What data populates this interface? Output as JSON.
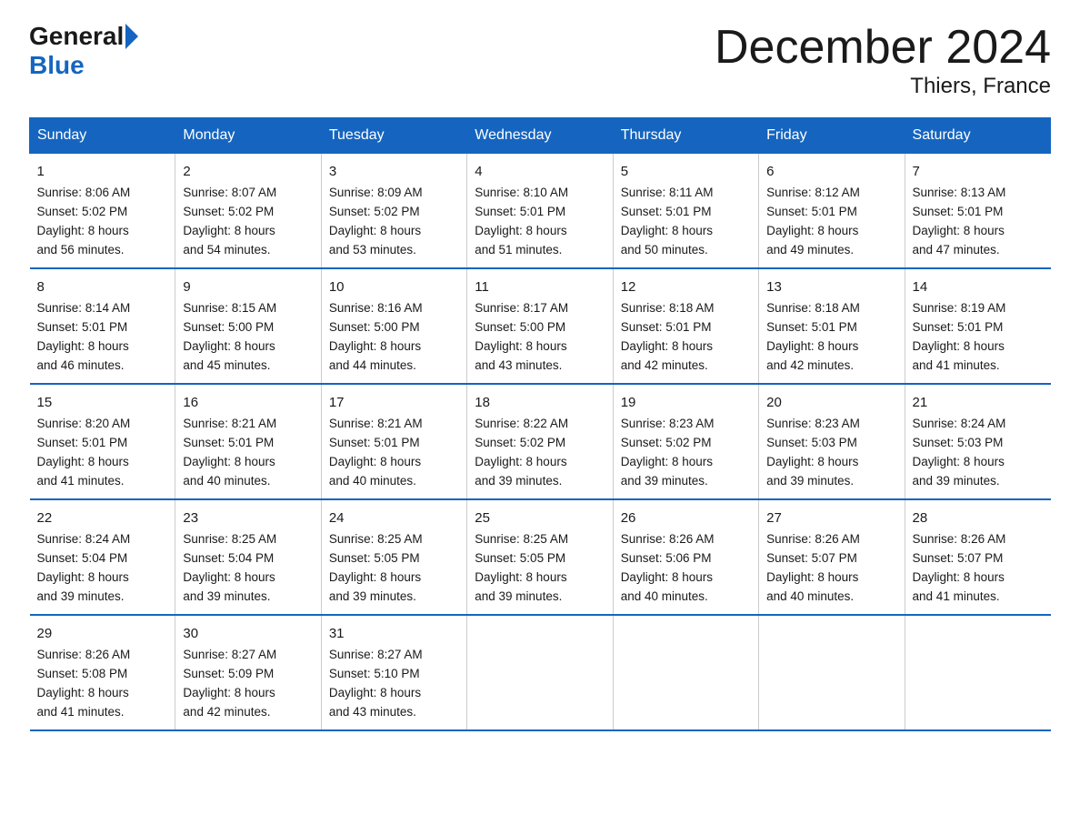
{
  "logo": {
    "general": "General",
    "blue": "Blue"
  },
  "title": "December 2024",
  "subtitle": "Thiers, France",
  "days_of_week": [
    "Sunday",
    "Monday",
    "Tuesday",
    "Wednesday",
    "Thursday",
    "Friday",
    "Saturday"
  ],
  "weeks": [
    [
      {
        "day": "1",
        "sunrise": "8:06 AM",
        "sunset": "5:02 PM",
        "daylight": "8 hours and 56 minutes."
      },
      {
        "day": "2",
        "sunrise": "8:07 AM",
        "sunset": "5:02 PM",
        "daylight": "8 hours and 54 minutes."
      },
      {
        "day": "3",
        "sunrise": "8:09 AM",
        "sunset": "5:02 PM",
        "daylight": "8 hours and 53 minutes."
      },
      {
        "day": "4",
        "sunrise": "8:10 AM",
        "sunset": "5:01 PM",
        "daylight": "8 hours and 51 minutes."
      },
      {
        "day": "5",
        "sunrise": "8:11 AM",
        "sunset": "5:01 PM",
        "daylight": "8 hours and 50 minutes."
      },
      {
        "day": "6",
        "sunrise": "8:12 AM",
        "sunset": "5:01 PM",
        "daylight": "8 hours and 49 minutes."
      },
      {
        "day": "7",
        "sunrise": "8:13 AM",
        "sunset": "5:01 PM",
        "daylight": "8 hours and 47 minutes."
      }
    ],
    [
      {
        "day": "8",
        "sunrise": "8:14 AM",
        "sunset": "5:01 PM",
        "daylight": "8 hours and 46 minutes."
      },
      {
        "day": "9",
        "sunrise": "8:15 AM",
        "sunset": "5:00 PM",
        "daylight": "8 hours and 45 minutes."
      },
      {
        "day": "10",
        "sunrise": "8:16 AM",
        "sunset": "5:00 PM",
        "daylight": "8 hours and 44 minutes."
      },
      {
        "day": "11",
        "sunrise": "8:17 AM",
        "sunset": "5:00 PM",
        "daylight": "8 hours and 43 minutes."
      },
      {
        "day": "12",
        "sunrise": "8:18 AM",
        "sunset": "5:01 PM",
        "daylight": "8 hours and 42 minutes."
      },
      {
        "day": "13",
        "sunrise": "8:18 AM",
        "sunset": "5:01 PM",
        "daylight": "8 hours and 42 minutes."
      },
      {
        "day": "14",
        "sunrise": "8:19 AM",
        "sunset": "5:01 PM",
        "daylight": "8 hours and 41 minutes."
      }
    ],
    [
      {
        "day": "15",
        "sunrise": "8:20 AM",
        "sunset": "5:01 PM",
        "daylight": "8 hours and 41 minutes."
      },
      {
        "day": "16",
        "sunrise": "8:21 AM",
        "sunset": "5:01 PM",
        "daylight": "8 hours and 40 minutes."
      },
      {
        "day": "17",
        "sunrise": "8:21 AM",
        "sunset": "5:01 PM",
        "daylight": "8 hours and 40 minutes."
      },
      {
        "day": "18",
        "sunrise": "8:22 AM",
        "sunset": "5:02 PM",
        "daylight": "8 hours and 39 minutes."
      },
      {
        "day": "19",
        "sunrise": "8:23 AM",
        "sunset": "5:02 PM",
        "daylight": "8 hours and 39 minutes."
      },
      {
        "day": "20",
        "sunrise": "8:23 AM",
        "sunset": "5:03 PM",
        "daylight": "8 hours and 39 minutes."
      },
      {
        "day": "21",
        "sunrise": "8:24 AM",
        "sunset": "5:03 PM",
        "daylight": "8 hours and 39 minutes."
      }
    ],
    [
      {
        "day": "22",
        "sunrise": "8:24 AM",
        "sunset": "5:04 PM",
        "daylight": "8 hours and 39 minutes."
      },
      {
        "day": "23",
        "sunrise": "8:25 AM",
        "sunset": "5:04 PM",
        "daylight": "8 hours and 39 minutes."
      },
      {
        "day": "24",
        "sunrise": "8:25 AM",
        "sunset": "5:05 PM",
        "daylight": "8 hours and 39 minutes."
      },
      {
        "day": "25",
        "sunrise": "8:25 AM",
        "sunset": "5:05 PM",
        "daylight": "8 hours and 39 minutes."
      },
      {
        "day": "26",
        "sunrise": "8:26 AM",
        "sunset": "5:06 PM",
        "daylight": "8 hours and 40 minutes."
      },
      {
        "day": "27",
        "sunrise": "8:26 AM",
        "sunset": "5:07 PM",
        "daylight": "8 hours and 40 minutes."
      },
      {
        "day": "28",
        "sunrise": "8:26 AM",
        "sunset": "5:07 PM",
        "daylight": "8 hours and 41 minutes."
      }
    ],
    [
      {
        "day": "29",
        "sunrise": "8:26 AM",
        "sunset": "5:08 PM",
        "daylight": "8 hours and 41 minutes."
      },
      {
        "day": "30",
        "sunrise": "8:27 AM",
        "sunset": "5:09 PM",
        "daylight": "8 hours and 42 minutes."
      },
      {
        "day": "31",
        "sunrise": "8:27 AM",
        "sunset": "5:10 PM",
        "daylight": "8 hours and 43 minutes."
      },
      null,
      null,
      null,
      null
    ]
  ],
  "labels": {
    "sunrise": "Sunrise:",
    "sunset": "Sunset:",
    "daylight": "Daylight:"
  }
}
